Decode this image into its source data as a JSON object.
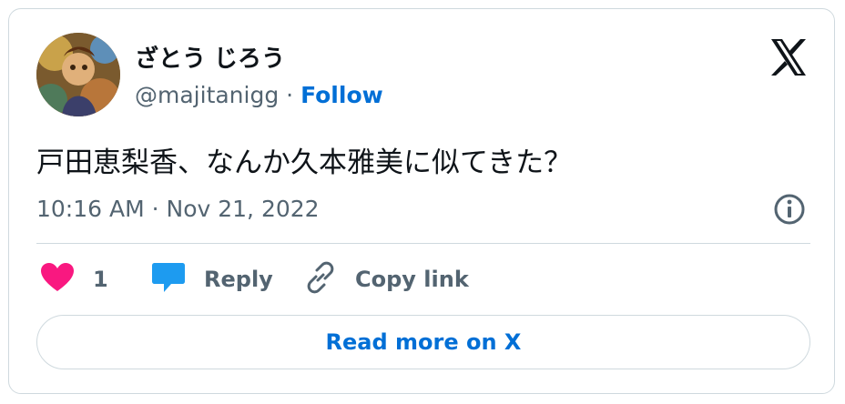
{
  "author": {
    "display_name": "ざとう じろう",
    "handle": "@majitanigg",
    "separator": " · ",
    "follow_label": "Follow"
  },
  "tweet": {
    "text": "戸田恵梨香、なんか久本雅美に似てきた？",
    "timestamp": "10:16 AM · Nov 21, 2022"
  },
  "actions": {
    "like_count": "1",
    "reply_label": "Reply",
    "copy_label": "Copy link"
  },
  "read_more_label": "Read more on X",
  "icons": {
    "brand": "x-logo-icon",
    "info": "info-icon",
    "like": "heart-icon",
    "reply": "speech-bubble-icon",
    "copy": "link-icon"
  },
  "colors": {
    "text_primary": "#0f1419",
    "text_secondary": "#536471",
    "link_blue": "#006fd6",
    "heart_pink": "#f91880",
    "reply_blue": "#1d9bf0",
    "border": "#cfd9de"
  }
}
